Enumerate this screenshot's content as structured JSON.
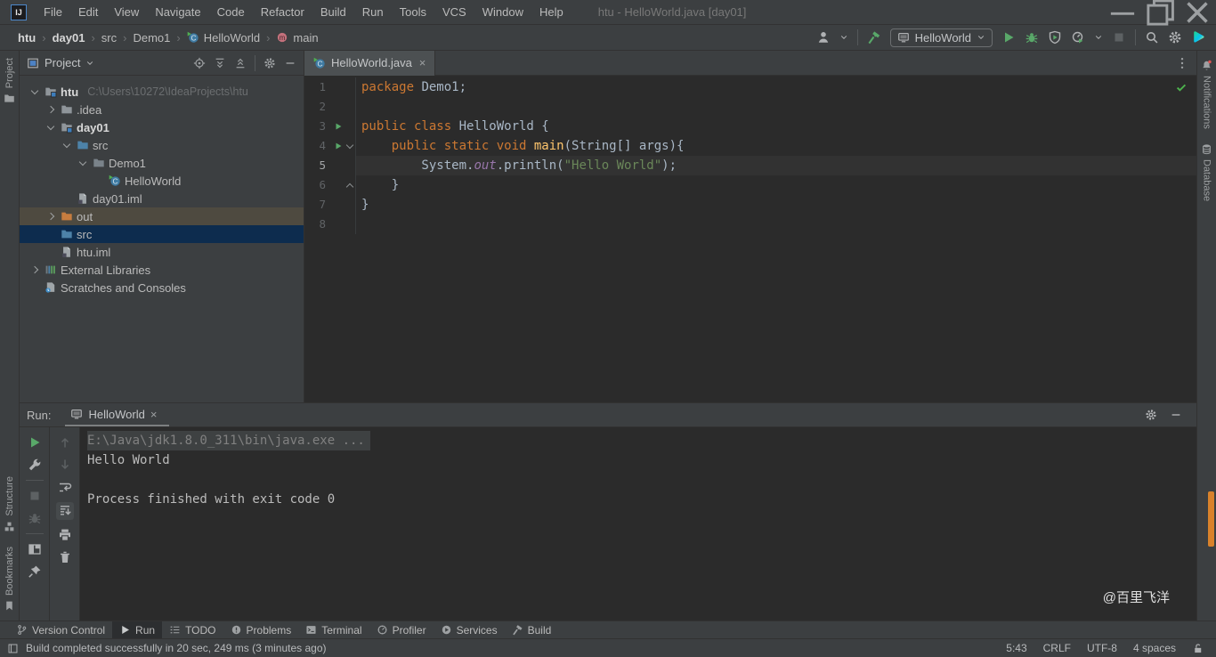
{
  "titlebar": {
    "logo_text": "IJ",
    "menus": [
      "File",
      "Edit",
      "View",
      "Navigate",
      "Code",
      "Refactor",
      "Build",
      "Run",
      "Tools",
      "VCS",
      "Window",
      "Help"
    ],
    "title": "htu - HelloWorld.java [day01]"
  },
  "navbar": {
    "separator": "›",
    "breadcrumbs": [
      {
        "label": "htu",
        "bold": true
      },
      {
        "label": "day01",
        "bold": true
      },
      {
        "label": "src"
      },
      {
        "label": "Demo1"
      },
      {
        "label": "HelloWorld",
        "icon": "class-run"
      },
      {
        "label": "main",
        "icon": "method"
      }
    ],
    "run_config": {
      "label": "HelloWorld"
    }
  },
  "project": {
    "header_title": "Project",
    "tree": [
      {
        "level": 0,
        "arrow": "open",
        "icon": "folder-module",
        "iconcls": "ic-folder",
        "label": "htu",
        "bold": true,
        "suffix": "C:\\Users\\10272\\IdeaProjects\\htu"
      },
      {
        "level": 1,
        "arrow": "closed",
        "icon": "folder",
        "iconcls": "ic-folder",
        "label": ".idea"
      },
      {
        "level": 1,
        "arrow": "open",
        "icon": "folder-module",
        "iconcls": "ic-folder",
        "label": "day01",
        "bold": true
      },
      {
        "level": 2,
        "arrow": "open",
        "icon": "folder",
        "iconcls": "ic-folder-src",
        "label": "src"
      },
      {
        "level": 3,
        "arrow": "open",
        "icon": "folder",
        "iconcls": "ic-folder-pkg",
        "label": "Demo1"
      },
      {
        "level": 4,
        "arrow": "none",
        "icon": "class-run",
        "iconcls": "",
        "label": "HelloWorld"
      },
      {
        "level": 2,
        "arrow": "none",
        "icon": "file-iml",
        "iconcls": "",
        "label": "day01.iml"
      },
      {
        "level": 1,
        "arrow": "closed",
        "icon": "folder",
        "iconcls": "ic-folder-x",
        "label": "out",
        "state": "hover"
      },
      {
        "level": 1,
        "arrow": "none",
        "icon": "folder",
        "iconcls": "ic-folder-src",
        "label": "src",
        "state": "selected"
      },
      {
        "level": 1,
        "arrow": "none",
        "icon": "file-iml",
        "iconcls": "",
        "label": "htu.iml"
      },
      {
        "level": 0,
        "arrow": "closed",
        "icon": "libraries",
        "iconcls": "",
        "label": "External Libraries"
      },
      {
        "level": 0,
        "arrow": "none",
        "icon": "scratches",
        "iconcls": "",
        "label": "Scratches and Consoles"
      }
    ]
  },
  "editor": {
    "tab_label": "HelloWorld.java",
    "tab_close": "×",
    "lines": [
      {
        "n": "1",
        "tokens": [
          {
            "t": "package ",
            "c": "kw"
          },
          {
            "t": "Demo1;",
            "c": "pl"
          }
        ]
      },
      {
        "n": "2",
        "tokens": []
      },
      {
        "n": "3",
        "run": true,
        "tokens": [
          {
            "t": "public class ",
            "c": "kw"
          },
          {
            "t": "HelloWorld {",
            "c": "pl"
          }
        ]
      },
      {
        "n": "4",
        "run": true,
        "fold": "open",
        "tokens": [
          {
            "t": "    ",
            "c": "pl"
          },
          {
            "t": "public static void ",
            "c": "kw"
          },
          {
            "t": "main",
            "c": "fn"
          },
          {
            "t": "(String[] args){",
            "c": "pl"
          }
        ]
      },
      {
        "n": "5",
        "caret": true,
        "tokens": [
          {
            "t": "        System.",
            "c": "pl"
          },
          {
            "t": "out",
            "c": "field"
          },
          {
            "t": ".println(",
            "c": "pl"
          },
          {
            "t": "\"Hello World\"",
            "c": "str"
          },
          {
            "t": ");",
            "c": "pl"
          }
        ]
      },
      {
        "n": "6",
        "fold": "close",
        "tokens": [
          {
            "t": "    }",
            "c": "pl"
          }
        ]
      },
      {
        "n": "7",
        "tokens": [
          {
            "t": "}",
            "c": "pl"
          }
        ]
      },
      {
        "n": "8",
        "tokens": []
      }
    ]
  },
  "run_panel": {
    "label": "Run:",
    "tab_label": "HelloWorld",
    "tab_close": "×",
    "console": [
      {
        "text": "E:\\Java\\jdk1.8.0_311\\bin\\java.exe ...",
        "style": "cmd"
      },
      {
        "text": "Hello World",
        "style": "plain"
      },
      {
        "text": "",
        "style": "plain"
      },
      {
        "text": "Process finished with exit code 0",
        "style": "plain"
      }
    ],
    "watermark": "@百里飞洋"
  },
  "toolwindow_bar": {
    "items": [
      {
        "icon": "branch",
        "label": "Version Control"
      },
      {
        "icon": "play",
        "label": "Run",
        "active": true
      },
      {
        "icon": "list",
        "label": "TODO"
      },
      {
        "icon": "problem",
        "label": "Problems"
      },
      {
        "icon": "terminal",
        "label": "Terminal"
      },
      {
        "icon": "gauge-mono",
        "label": "Profiler"
      },
      {
        "icon": "services",
        "label": "Services"
      },
      {
        "icon": "hammer",
        "label": "Build"
      }
    ]
  },
  "statusbar": {
    "message": "Build completed successfully in 20 sec, 249 ms (3 minutes ago)",
    "items": [
      "5:43",
      "CRLF",
      "UTF-8",
      "4 spaces"
    ]
  },
  "stripes": {
    "left_top": [
      {
        "icon": "toolwindow-folder",
        "label": "Project"
      }
    ],
    "left_bottom": [
      {
        "icon": "structure",
        "label": "Structure"
      },
      {
        "icon": "bookmark",
        "label": "Bookmarks"
      }
    ],
    "right": [
      {
        "icon": "bell",
        "label": "Notifications"
      },
      {
        "icon": "database",
        "label": "Database"
      }
    ]
  },
  "icons": {
    "search": "magnifier",
    "settings": "gear",
    "run": "green play triangle",
    "debug": "green bug",
    "coverage": "shield with play",
    "profiler": "gauge with play",
    "stop": "gray square",
    "toolbox": "gradient triangle",
    "notifications": "bell with red badge",
    "database": "disk stack",
    "class": "blue circle C with run overlay",
    "method": "pink circle m"
  },
  "colors": {
    "panel": "#3c3f41",
    "editor_bg": "#2b2b2b",
    "caret_line": "#323232",
    "selection": "#0d2c4e",
    "hover_row": "#4e4a40",
    "keyword": "#cc7832",
    "string": "#6a8759",
    "method": "#ffc66d",
    "field": "#9876aa",
    "plain": "#a9b7c6",
    "accent_green": "#59A869",
    "excluded_folder": "#c77d3f",
    "stripe_marker": "#d9822b"
  }
}
